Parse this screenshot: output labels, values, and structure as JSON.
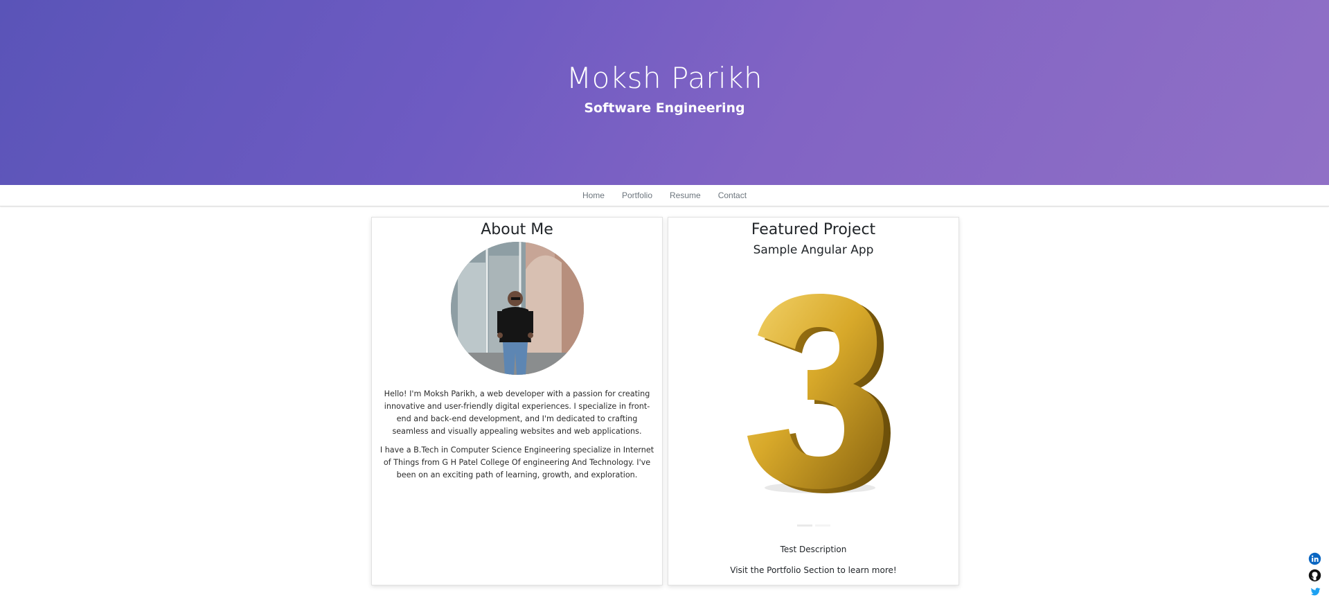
{
  "hero": {
    "name": "Moksh Parikh",
    "subtitle": "Software Engineering"
  },
  "nav": {
    "items": [
      {
        "label": "Home"
      },
      {
        "label": "Portfolio"
      },
      {
        "label": "Resume"
      },
      {
        "label": "Contact"
      }
    ]
  },
  "about": {
    "title": "About Me",
    "paragraphs": [
      "Hello! I'm Moksh Parikh, a web developer with a passion for creating innovative and user-friendly digital experiences. I specialize in front-end and back-end development, and I'm dedicated to crafting seamless and visually appealing websites and web applications.",
      "I have a B.Tech in Computer Science Engineering specialize in Internet of Things from G H Patel College Of engineering And Technology. I've been on an exciting path of learning, growth, and exploration."
    ]
  },
  "project": {
    "title": "Featured Project",
    "subtitle": "Sample Angular App",
    "image_icon": "gold-number-three-image",
    "description": "Test Description",
    "cta": "Visit the Portfolio Section to learn more!",
    "slide_count": 2,
    "active_slide": 2
  },
  "social": {
    "icons": [
      "linkedin-icon",
      "github-icon",
      "twitter-icon"
    ]
  },
  "colors": {
    "hero_gradient_start": "#5a54b8",
    "hero_gradient_end": "#9070c6",
    "linkedin": "#0a66c2",
    "github": "#111111",
    "twitter": "#1da1f2"
  }
}
